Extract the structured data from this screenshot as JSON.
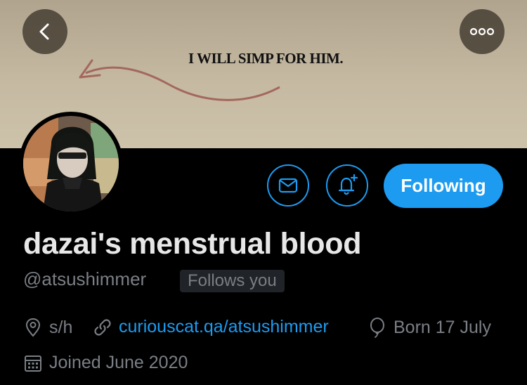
{
  "banner": {
    "text": "I WILL SIMP FOR HIM."
  },
  "nav": {
    "back_icon": "chevron-left-icon",
    "more_icon": "more-dots-icon"
  },
  "actions": {
    "message_icon": "mail-icon",
    "notify_icon": "bell-plus-icon",
    "following_label": "Following"
  },
  "profile": {
    "display_name": "dazai's menstrual blood",
    "handle": "@atsushimmer",
    "follows_you": "Follows you",
    "location": "s/h",
    "website": "curiouscat.qa/atsushimmer",
    "birthday": "Born 17 July",
    "joined": "Joined June 2020"
  },
  "colors": {
    "accent": "#1d9bf0",
    "background": "#000000",
    "muted": "#7a7f85"
  }
}
